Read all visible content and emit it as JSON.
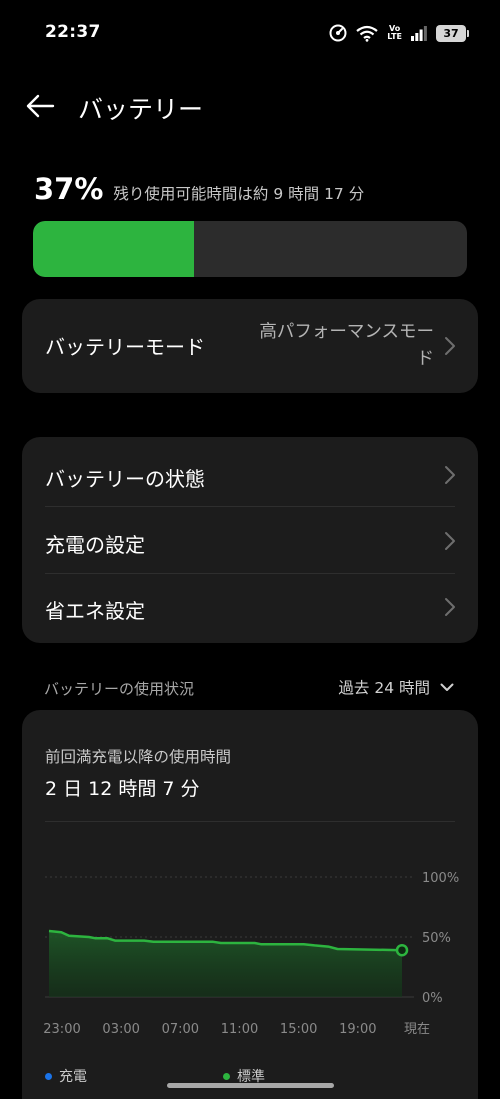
{
  "status_bar": {
    "time": "22:37",
    "volte_top": "Vo",
    "volte_bottom": "LTE",
    "battery_level": "37"
  },
  "header": {
    "title": "バッテリー",
    "back_icon": "arrow-left-icon"
  },
  "battery": {
    "percent": "37%",
    "level_fraction": 0.37,
    "remaining_text": "残り使用可能時間は約 9 時間 17 分",
    "fill_color": "#2db43f"
  },
  "mode_card": {
    "label": "バッテリーモード",
    "value": "高パフォーマンスモード"
  },
  "settings": [
    {
      "label": "バッテリーの状態"
    },
    {
      "label": "充電の設定"
    },
    {
      "label": "省エネ設定"
    }
  ],
  "usage": {
    "section_title": "バッテリーの使用状況",
    "range_label": "過去 24 時間",
    "since_label": "前回満充電以降の使用時間",
    "since_value": "2 日 12 時間 7 分"
  },
  "chart_data": {
    "type": "area",
    "x_tick_labels": [
      "23:00",
      "03:00",
      "07:00",
      "11:00",
      "15:00",
      "19:00",
      "現在"
    ],
    "y_tick_labels": [
      "100%",
      "50%",
      "0%"
    ],
    "ylim": [
      0,
      100
    ],
    "xlim": [
      0,
      23
    ],
    "series": [
      {
        "name": "標準",
        "color": "#2db43f",
        "x": [
          0,
          0.8,
          1.3,
          2.6,
          3.0,
          3.8,
          4.3,
          6.2,
          6.8,
          10.7,
          11.2,
          13.4,
          13.8,
          16.6,
          17.3,
          18.2,
          18.8,
          23
        ],
        "values": [
          55,
          54,
          51,
          50,
          49,
          49,
          47,
          47,
          46,
          46,
          45,
          45,
          44,
          44,
          43,
          42,
          40,
          39
        ]
      }
    ],
    "legend": [
      {
        "label": "充電",
        "color": "#1a73e8"
      },
      {
        "label": "標準",
        "color": "#2db43f"
      }
    ],
    "grid": true,
    "legend_position": "bottom"
  }
}
